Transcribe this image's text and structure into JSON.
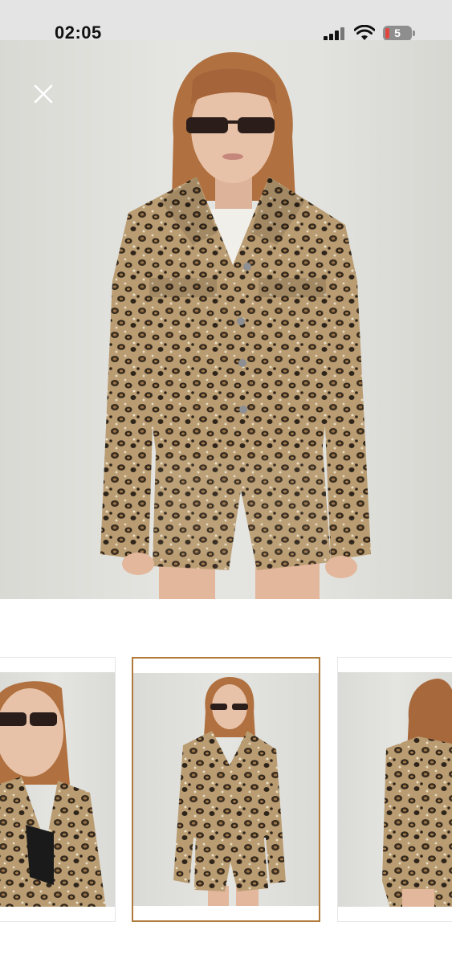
{
  "status_bar": {
    "time": "02:05",
    "battery_level": "5",
    "icons": [
      "cellular-signal-icon",
      "wifi-icon",
      "battery-icon"
    ]
  },
  "product_viewer": {
    "close_icon": "close-icon",
    "main_image_alt": "",
    "thumbnails": [
      {
        "selected": false
      },
      {
        "selected": true
      },
      {
        "selected": false
      }
    ]
  },
  "colors": {
    "selected_border": "#b07a3b",
    "battery_low": "#e2473f",
    "status_bar_bg": "#e4e4e4"
  }
}
